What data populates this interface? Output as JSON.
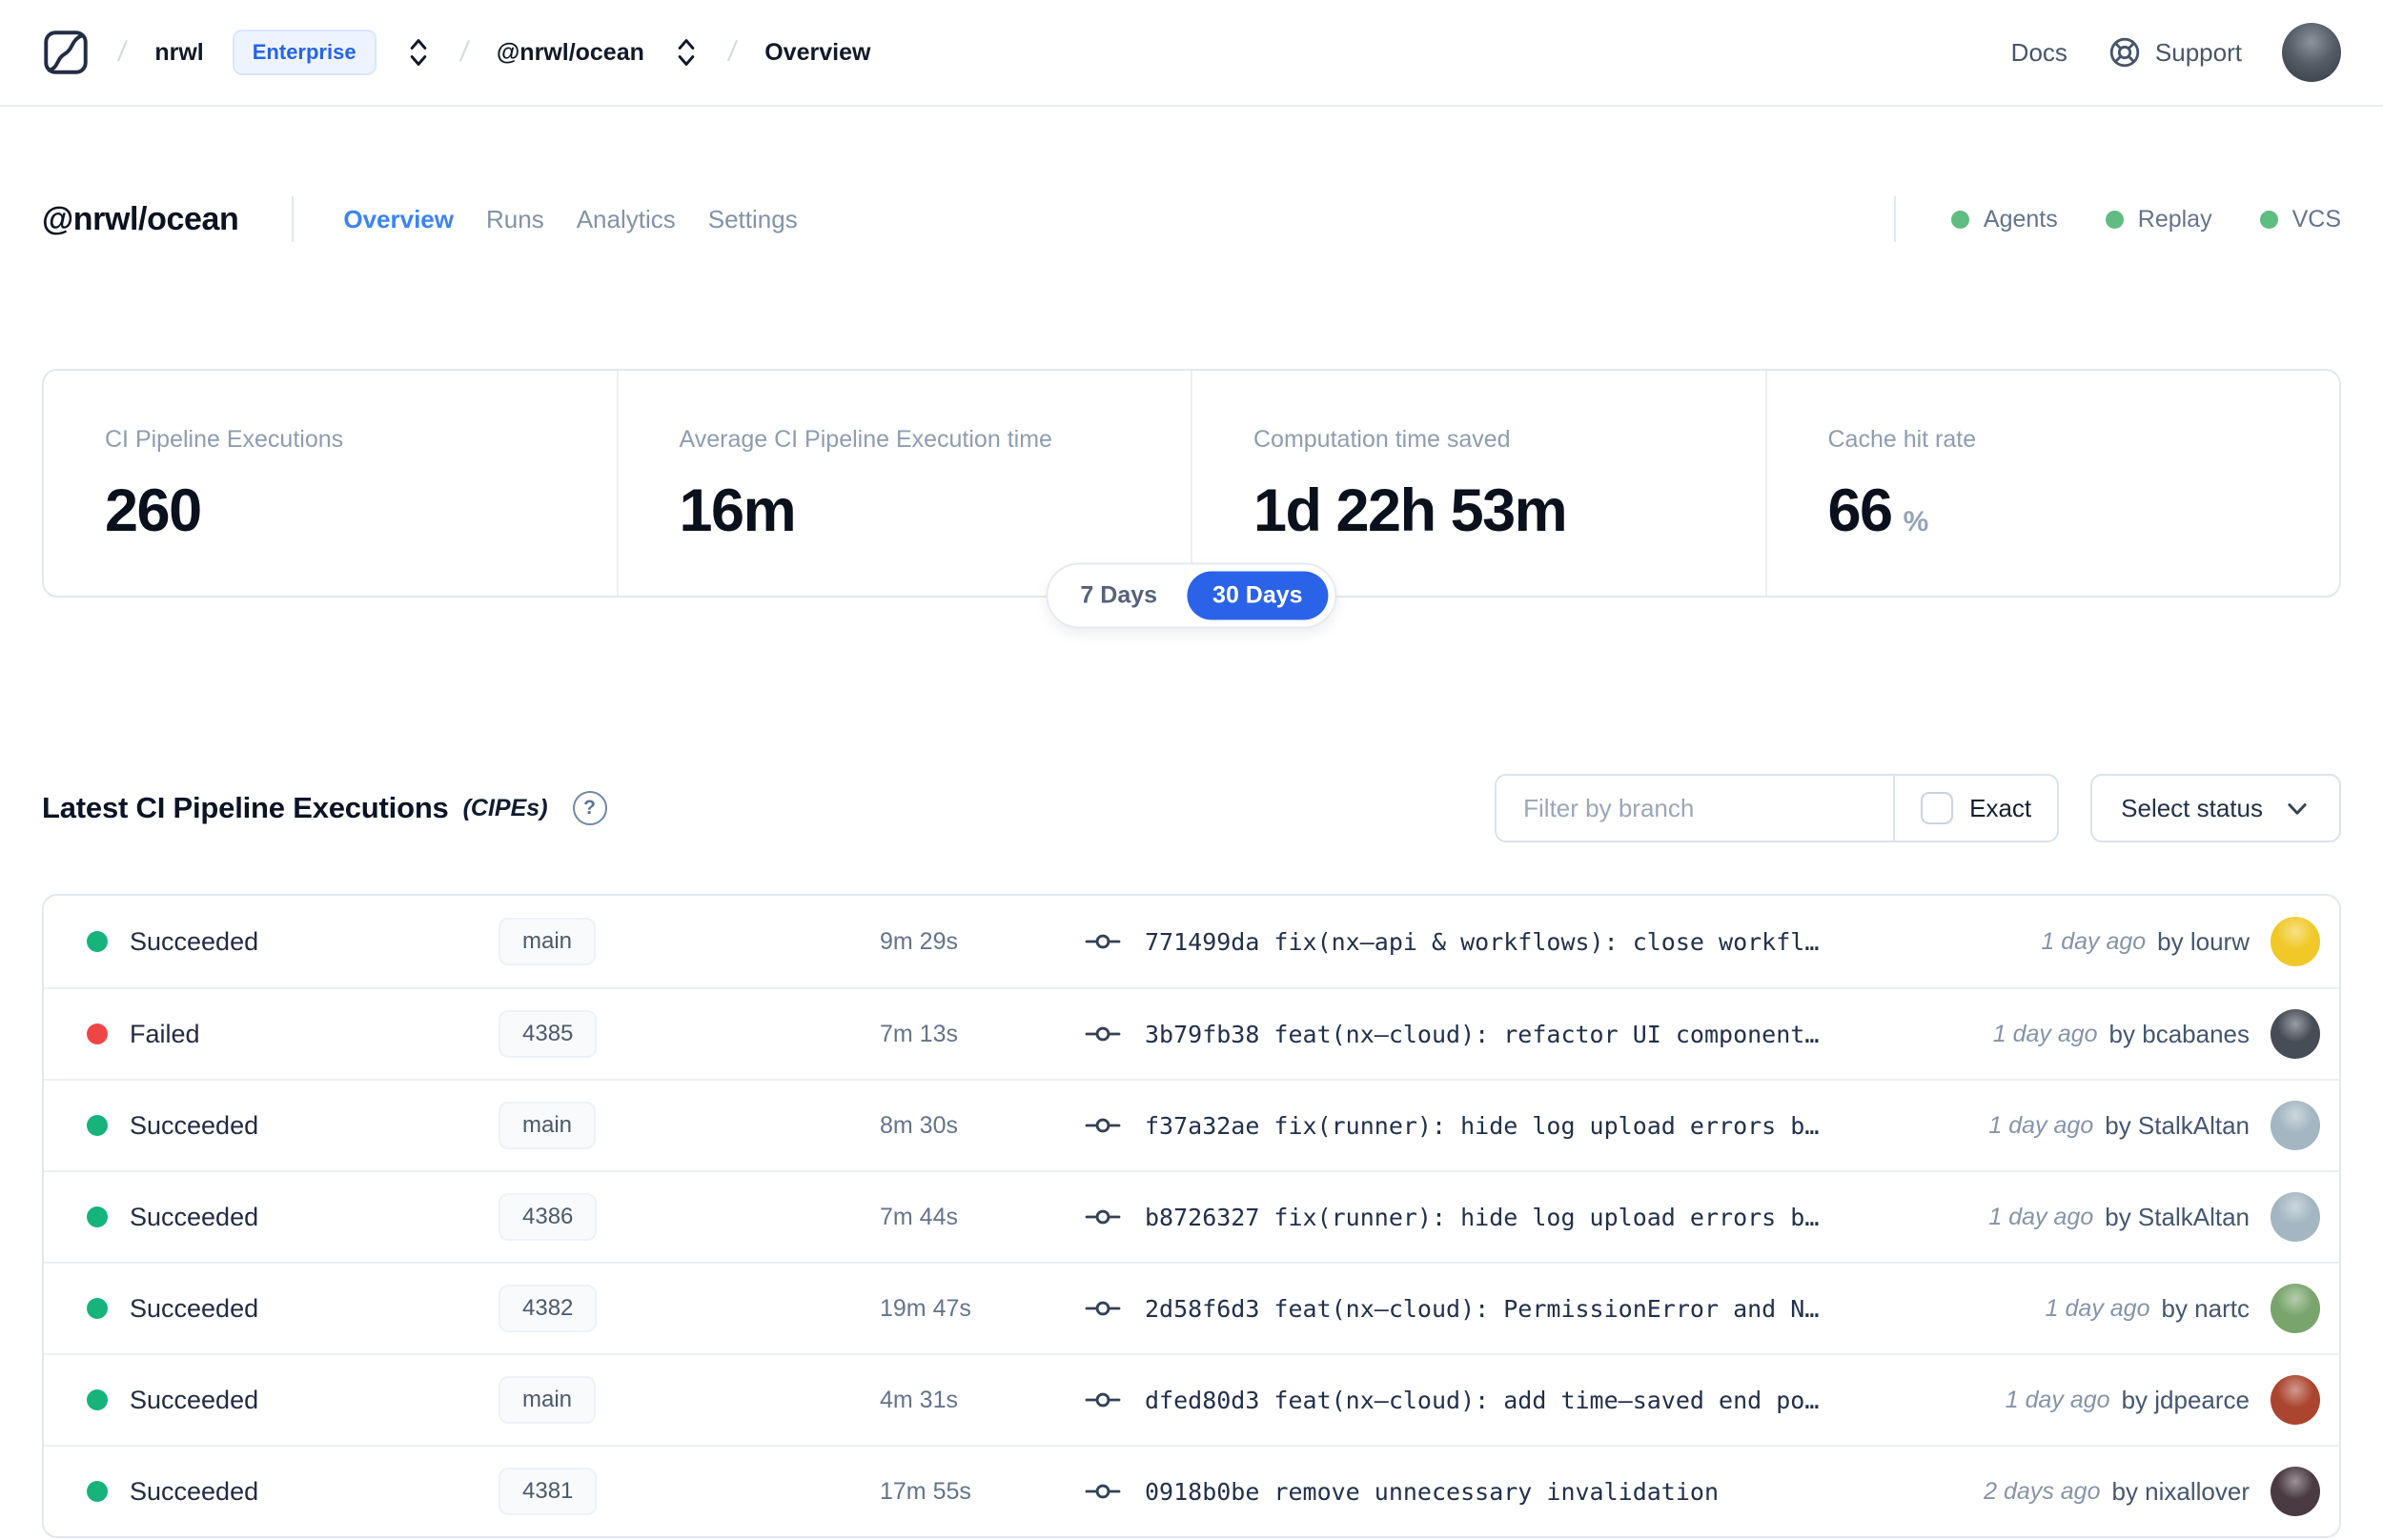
{
  "colors": {
    "accent_blue": "#2a63e8",
    "tab_active_blue": "#3c83f6",
    "enterprise_blue": "#2563eb",
    "success_green": "#16b37c",
    "failure_red": "#ee4646",
    "indicator_green": "#5fbd82"
  },
  "topnav": {
    "org": "nrwl",
    "org_badge": "Enterprise",
    "workspace": "@nrwl/ocean",
    "page": "Overview",
    "docs_label": "Docs",
    "support_label": "Support"
  },
  "header": {
    "title": "@nrwl/ocean",
    "tabs": [
      {
        "label": "Overview"
      },
      {
        "label": "Runs"
      },
      {
        "label": "Analytics"
      },
      {
        "label": "Settings"
      }
    ],
    "indicators": [
      {
        "label": "Agents"
      },
      {
        "label": "Replay"
      },
      {
        "label": "VCS"
      }
    ]
  },
  "stats": [
    {
      "label": "CI Pipeline Executions",
      "value": "260",
      "suffix": ""
    },
    {
      "label": "Average CI Pipeline Execution time",
      "value": "16m",
      "suffix": ""
    },
    {
      "label": "Computation time saved",
      "value": "1d 22h 53m",
      "suffix": ""
    },
    {
      "label": "Cache hit rate",
      "value": "66",
      "suffix": "%"
    }
  ],
  "range_toggle": {
    "options": [
      "7 Days",
      "30 Days"
    ],
    "selected": "30 Days"
  },
  "section": {
    "title": "Latest CI Pipeline Executions",
    "subtitle": "(CIPEs)",
    "filter_placeholder": "Filter by branch",
    "exact_label": "Exact",
    "status_dropdown_label": "Select status"
  },
  "rows": [
    {
      "status": "Succeeded",
      "status_color": "#16b37c",
      "branch": "main",
      "duration": "9m 29s",
      "commit": {
        "hash": "771499da",
        "message": "fix(nx–api & workflows): close workfl…"
      },
      "ago": "1 day ago",
      "author": "by lourw",
      "avatar_color": "#f0c928"
    },
    {
      "status": "Failed",
      "status_color": "#ee4646",
      "branch": "4385",
      "duration": "7m 13s",
      "commit": {
        "hash": "3b79fb38",
        "message": "feat(nx–cloud): refactor UI component…"
      },
      "ago": "1 day ago",
      "author": "by bcabanes",
      "avatar_color": "#474d56"
    },
    {
      "status": "Succeeded",
      "status_color": "#16b37c",
      "branch": "main",
      "duration": "8m 30s",
      "commit": {
        "hash": "f37a32ae",
        "message": "fix(runner): hide log upload errors b…"
      },
      "ago": "1 day ago",
      "author": "by StalkAltan",
      "avatar_color": "#a3b6c2"
    },
    {
      "status": "Succeeded",
      "status_color": "#16b37c",
      "branch": "4386",
      "duration": "7m 44s",
      "commit": {
        "hash": "b8726327",
        "message": "fix(runner): hide log upload errors b…"
      },
      "ago": "1 day ago",
      "author": "by StalkAltan",
      "avatar_color": "#a3b6c2"
    },
    {
      "status": "Succeeded",
      "status_color": "#16b37c",
      "branch": "4382",
      "duration": "19m 47s",
      "commit": {
        "hash": "2d58f6d3",
        "message": "feat(nx–cloud): PermissionError and N…"
      },
      "ago": "1 day ago",
      "author": "by nartc",
      "avatar_color": "#79a46c"
    },
    {
      "status": "Succeeded",
      "status_color": "#16b37c",
      "branch": "main",
      "duration": "4m 31s",
      "commit": {
        "hash": "dfed80d3",
        "message": "feat(nx–cloud): add time–saved end po…"
      },
      "ago": "1 day ago",
      "author": "by jdpearce",
      "avatar_color": "#ab452f"
    },
    {
      "status": "Succeeded",
      "status_color": "#16b37c",
      "branch": "4381",
      "duration": "17m 55s",
      "commit": {
        "hash": "0918b0be",
        "message": "remove unnecessary invalidation"
      },
      "ago": "2 days ago",
      "author": "by nixallover",
      "avatar_color": "#4a3a41"
    }
  ]
}
